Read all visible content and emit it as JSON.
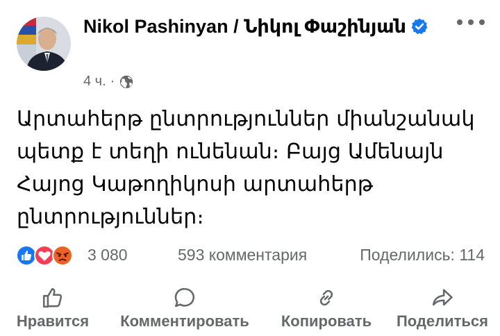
{
  "post": {
    "author_name": "Nikol Pashinyan / Նիկոլ Փաշինյան",
    "time": "4 ч.",
    "separator": "·",
    "text": "Արտահերթ ընտրություններ միանշանակ պետք է տեղի ունենան։ Բայց Ամենայն Հայոց Կաթողիկոսի արտահերթ ընտրություններ։"
  },
  "stats": {
    "reactions_count": "3 080",
    "comments": "593 комментария",
    "shares": "Поделились: 114"
  },
  "actions": {
    "like": "Нравится",
    "comment": "Комментировать",
    "copy": "Копировать",
    "share": "Поделиться"
  },
  "colors": {
    "verified": "#1877f2",
    "like": "#1877f2",
    "love": "#f33e58",
    "angry": "#e9710f",
    "muted": "#65676b"
  },
  "icons": [
    "avatar-photo",
    "verified-badge-icon",
    "globe-icon",
    "more-dots-icon",
    "like-reaction-icon",
    "love-reaction-icon",
    "angry-reaction-icon",
    "thumbs-up-icon",
    "comment-bubble-icon",
    "link-icon",
    "share-arrow-icon"
  ]
}
